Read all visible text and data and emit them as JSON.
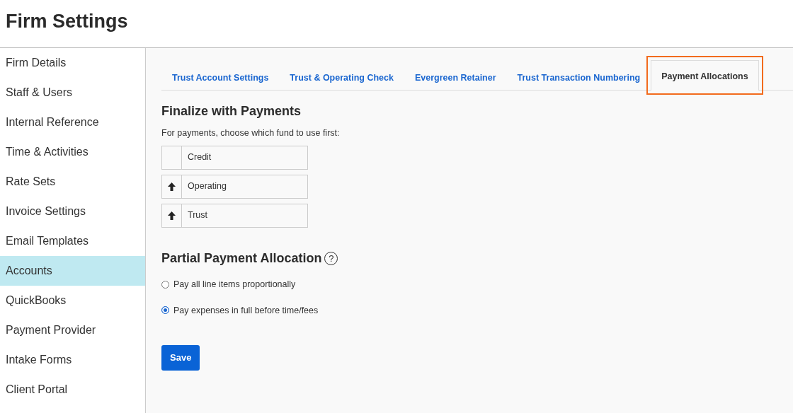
{
  "page": {
    "title": "Firm Settings"
  },
  "sidebar": {
    "items": [
      {
        "label": "Firm Details",
        "selected": false
      },
      {
        "label": "Staff & Users",
        "selected": false
      },
      {
        "label": "Internal Reference",
        "selected": false
      },
      {
        "label": "Time & Activities",
        "selected": false
      },
      {
        "label": "Rate Sets",
        "selected": false
      },
      {
        "label": "Invoice Settings",
        "selected": false
      },
      {
        "label": "Email Templates",
        "selected": false
      },
      {
        "label": "Accounts",
        "selected": true
      },
      {
        "label": "QuickBooks",
        "selected": false
      },
      {
        "label": "Payment Provider",
        "selected": false
      },
      {
        "label": "Intake Forms",
        "selected": false
      },
      {
        "label": "Client Portal",
        "selected": false
      }
    ]
  },
  "tabs": [
    {
      "label": "Trust Account Settings",
      "selected": false,
      "highlighted": false
    },
    {
      "label": "Trust & Operating Check",
      "selected": false,
      "highlighted": false
    },
    {
      "label": "Evergreen Retainer",
      "selected": false,
      "highlighted": false
    },
    {
      "label": "Trust Transaction Numbering",
      "selected": false,
      "highlighted": false
    },
    {
      "label": "Payment Allocations",
      "selected": true,
      "highlighted": true
    }
  ],
  "finalize": {
    "heading": "Finalize with Payments",
    "description": "For payments, choose which fund to use first:",
    "funds": [
      {
        "label": "Credit",
        "can_move_up": false
      },
      {
        "label": "Operating",
        "can_move_up": true
      },
      {
        "label": "Trust",
        "can_move_up": true
      }
    ]
  },
  "partial": {
    "heading": "Partial Payment Allocation",
    "help_icon": "?",
    "options": [
      {
        "label": "Pay all line items proportionally",
        "selected": false
      },
      {
        "label": "Pay expenses in full before time/fees",
        "selected": true
      }
    ]
  },
  "save_button": "Save"
}
